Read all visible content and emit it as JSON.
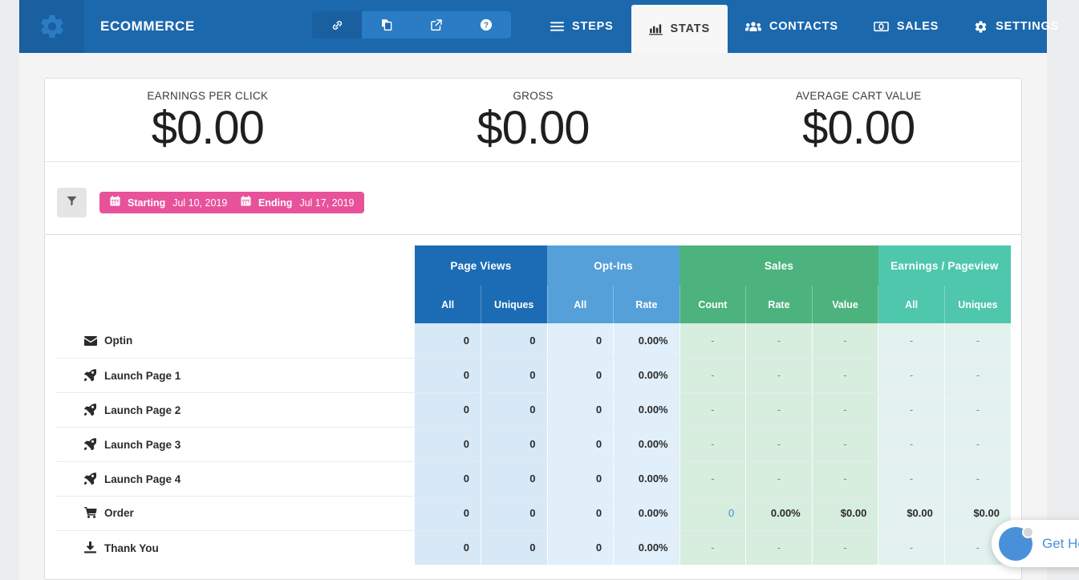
{
  "topbar": {
    "logo_icon": "gear-icon",
    "brand": "ECOMMERCE",
    "icon_buttons": [
      {
        "icon": "link-icon",
        "active": true
      },
      {
        "icon": "copy-icon",
        "active": false
      },
      {
        "icon": "external-link-icon",
        "active": false
      },
      {
        "icon": "question-circle-icon",
        "active": false
      }
    ],
    "tabs": [
      {
        "label": "STEPS",
        "icon": "bars-icon",
        "active": false
      },
      {
        "label": "STATS",
        "icon": "bar-chart-icon",
        "active": true
      },
      {
        "label": "CONTACTS",
        "icon": "users-icon",
        "active": false
      },
      {
        "label": "SALES",
        "icon": "money-icon",
        "active": false
      },
      {
        "label": "SETTINGS",
        "icon": "gear-icon",
        "active": false
      }
    ],
    "colors": {
      "bar": "#1c68ad",
      "logo_block": "#1a5fa0",
      "active_tab_bg": "#f7f7f7"
    }
  },
  "summary": {
    "cards": [
      {
        "label": "EARNINGS PER CLICK",
        "value": "$0.00"
      },
      {
        "label": "GROSS",
        "value": "$0.00"
      },
      {
        "label": "AVERAGE CART VALUE",
        "value": "$0.00"
      }
    ]
  },
  "filters": {
    "filter_button_icon": "filter-icon",
    "start": {
      "icon": "calendar-icon",
      "label": "Starting",
      "value": "Jul 10, 2019"
    },
    "end": {
      "icon": "calendar-icon",
      "label": "Ending",
      "value": "Jul 17, 2019"
    },
    "pill_color": "#e8529a"
  },
  "table": {
    "groups": [
      {
        "label": "",
        "span": 1,
        "color": "#ffffff"
      },
      {
        "label": "Page Views",
        "span": 2,
        "color": "#1c6cb5"
      },
      {
        "label": "Opt-Ins",
        "span": 2,
        "color": "#55a0d8"
      },
      {
        "label": "Sales",
        "span": 3,
        "color": "#4cb37e"
      },
      {
        "label": "Earnings / Pageview",
        "span": 2,
        "color": "#4ec7ac"
      }
    ],
    "subheaders": [
      "",
      "All",
      "Uniques",
      "All",
      "Rate",
      "Count",
      "Rate",
      "Value",
      "All",
      "Uniques"
    ],
    "rows": [
      {
        "icon": "envelope-icon",
        "label": "Optin",
        "cells": [
          "0",
          "0",
          "0",
          "0.00%",
          "-",
          "-",
          "-",
          "-",
          "-"
        ]
      },
      {
        "icon": "rocket-icon",
        "label": "Launch Page 1",
        "cells": [
          "0",
          "0",
          "0",
          "0.00%",
          "-",
          "-",
          "-",
          "-",
          "-"
        ]
      },
      {
        "icon": "rocket-icon",
        "label": "Launch Page 2",
        "cells": [
          "0",
          "0",
          "0",
          "0.00%",
          "-",
          "-",
          "-",
          "-",
          "-"
        ]
      },
      {
        "icon": "rocket-icon",
        "label": "Launch Page 3",
        "cells": [
          "0",
          "0",
          "0",
          "0.00%",
          "-",
          "-",
          "-",
          "-",
          "-"
        ]
      },
      {
        "icon": "rocket-icon",
        "label": "Launch Page 4",
        "cells": [
          "0",
          "0",
          "0",
          "0.00%",
          "-",
          "-",
          "-",
          "-",
          "-"
        ]
      },
      {
        "icon": "shopping-cart-icon",
        "label": "Order",
        "cells": [
          "0",
          "0",
          "0",
          "0.00%",
          "0",
          "0.00%",
          "$0.00",
          "$0.00",
          "$0.00"
        ],
        "link_cells": [
          4
        ]
      },
      {
        "icon": "download-icon",
        "label": "Thank You",
        "cells": [
          "0",
          "0",
          "0",
          "0.00%",
          "-",
          "-",
          "-",
          "-",
          "-"
        ]
      }
    ]
  },
  "chat": {
    "text": "Get He",
    "avatar_icon": "chat-avatar-icon",
    "color": "#4a90d9"
  }
}
